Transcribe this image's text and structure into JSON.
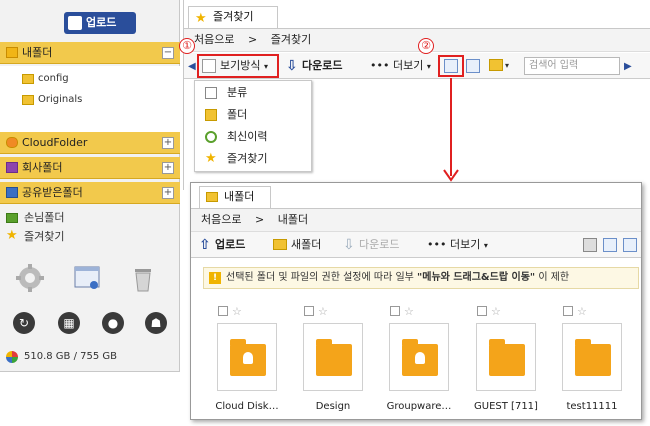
{
  "sidebar": {
    "upload_label": "업로드",
    "my_folder": {
      "label": "내폴더",
      "toggle": "−"
    },
    "tree": [
      "config",
      "Originals"
    ],
    "cloud_folder": "CloudFolder",
    "company_folder": "회사폴더",
    "shared_folder": "공유받은폴더",
    "expand": "+",
    "guest_folder": "손님폴더",
    "favorites": "즐겨찾기",
    "storage": "510.8 GB / 755 GB"
  },
  "top": {
    "tab_label": "즐겨찾기",
    "crumb_home": "처음으로",
    "crumb_sep": ">",
    "crumb_current": "즐겨찾기",
    "view_mode": "보기방식",
    "download": "다운로드",
    "more": "••• 더보기",
    "search_placeholder": "검색어 입력",
    "marker1": "①",
    "marker2": "②"
  },
  "menu": [
    "분류",
    "폴더",
    "최신이력",
    "즐겨찾기"
  ],
  "win2": {
    "tab_label": "내폴더",
    "crumb_home": "처음으로",
    "crumb_sep": ">",
    "crumb_current": "내폴더",
    "upload": "업로드",
    "new_folder": "새폴더",
    "download": "다운로드",
    "more": "••• 더보기",
    "notice_pre": "선택된 폴더 및 파일의 권한 설정에 따라 일부 ",
    "notice_bold": "\"메뉴와 드래그&드랍 이동\"",
    "notice_post": " 이 제한",
    "files": [
      "Cloud Disk…",
      "Design",
      "Groupware…",
      "GUEST [711]",
      "test11111"
    ]
  },
  "colors": {
    "accent_blue": "#2a4e9b",
    "highlight_yellow": "#f2c94c",
    "annotation_red": "#e02020"
  }
}
